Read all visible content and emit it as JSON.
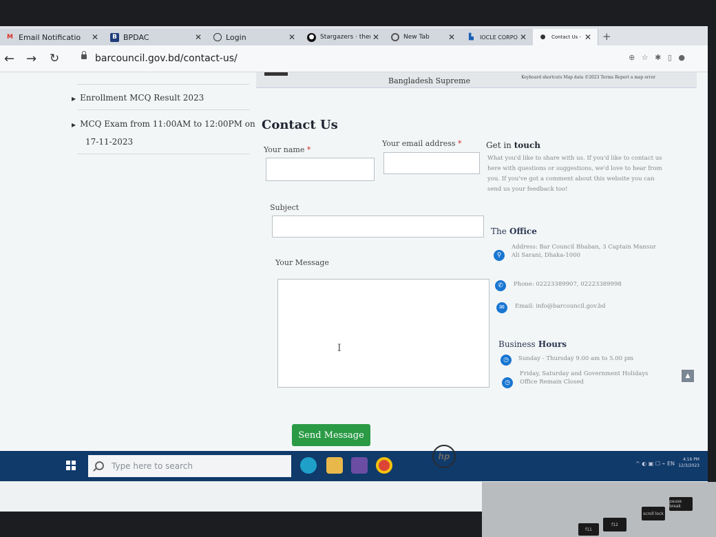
{
  "browser": {
    "tabs": [
      {
        "label": "Email Notificatio",
        "icon": "gmail-icon"
      },
      {
        "label": "BPDAC",
        "icon": "bpdac-icon"
      },
      {
        "label": "Login",
        "icon": "globe-icon"
      },
      {
        "label": "Stargazers · ther",
        "icon": "github-icon"
      },
      {
        "label": "New Tab",
        "icon": "chrome-icon"
      },
      {
        "label": "IOCLE CORPOR",
        "icon": "iocle-icon"
      },
      {
        "label": "Contact Us - Ba",
        "icon": "site-icon"
      }
    ],
    "new_tab_label": "+",
    "url": "barcouncil.gov.bd/contact-us/"
  },
  "map": {
    "label": "Bangladesh Supreme",
    "footer": "Keyboard shortcuts   Map data ©2023   Terms   Report a map error"
  },
  "sidebar": {
    "items": [
      {
        "label": "Enrollment MCQ Result 2023"
      },
      {
        "label": "MCQ Exam from 11:00AM to 12:00PM on",
        "line2": "17-11-2023"
      }
    ]
  },
  "form": {
    "title": "Contact Us",
    "name_label": "Your name",
    "email_label": "Your email address",
    "subject_label": "Subject",
    "message_label": "Your Message",
    "required_mark": "*",
    "submit_label": "Send Message"
  },
  "info": {
    "get_in_touch_prefix": "Get in",
    "get_in_touch_suffix": "touch",
    "intro": "What you'd like to share with us. If you'd like to contact us here with questions or suggestions, we'd love to hear from you. If you've got a comment about this website you can send us your feedback too!",
    "office_prefix": "The",
    "office_suffix": "Office",
    "address": "Address: Bar Council Bhaban, 3 Captain Mansur Ali Sarani, Dhaka-1000",
    "phone": "Phone: 02223389907, 02223389998",
    "email": "Email: info@barcouncil.gov.bd",
    "hours_prefix": "Business",
    "hours_suffix": "Hours",
    "hours1": "Sunday - Thursday 9.00 am to 5.00 pm",
    "hours2": "Friday, Saturday and Government Holidays Office Remain Closed"
  },
  "taskbar": {
    "search_placeholder": "Type here to search",
    "time": "4:16 PM",
    "date": "12/3/2023"
  },
  "keyboard": {
    "keys": [
      "f11",
      "f12",
      "scroll lock",
      "pause break"
    ]
  },
  "colors": {
    "accent_green": "#2a9a45",
    "icon_blue": "#1976d2",
    "taskbar_blue": "#0f3a6a"
  }
}
